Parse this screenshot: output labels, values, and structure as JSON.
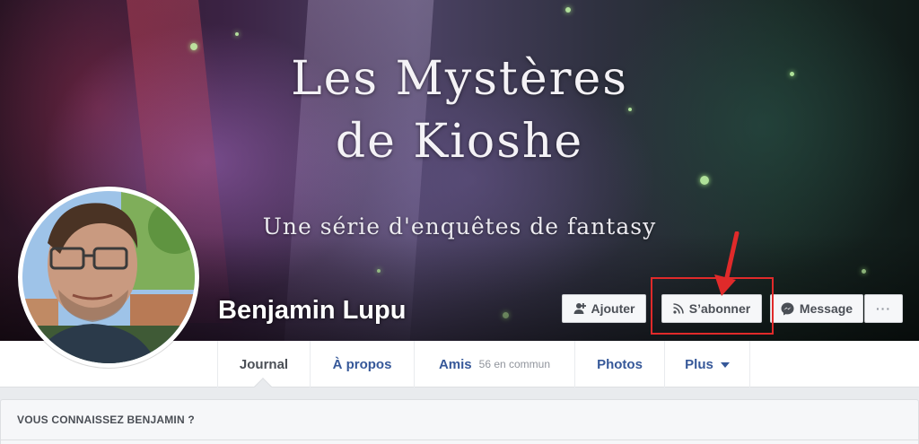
{
  "cover": {
    "title_line1": "Les Mystères",
    "title_line2": "de Kioshe",
    "subtitle": "Une série d'enquêtes de fantasy"
  },
  "profile": {
    "name": "Benjamin Lupu"
  },
  "actions": {
    "add_friend_label": "Ajouter",
    "subscribe_label": "S’abonner",
    "message_label": "Message",
    "more_label": "···"
  },
  "tabs": {
    "journal": "Journal",
    "about": "À propos",
    "friends": "Amis",
    "friends_count": "56 en commun",
    "photos": "Photos",
    "more": "Plus"
  },
  "card": {
    "title": "VOUS CONNAISSEZ BENJAMIN ?"
  },
  "colors": {
    "link_blue": "#365899",
    "highlight_red": "#e02a2a",
    "button_bg": "#f6f7f9",
    "page_bg": "#e9ebee"
  },
  "icons": [
    "add-friend-icon",
    "rss-icon",
    "messenger-icon",
    "ellipsis-icon",
    "caret-down-icon",
    "arrow-annotation"
  ]
}
